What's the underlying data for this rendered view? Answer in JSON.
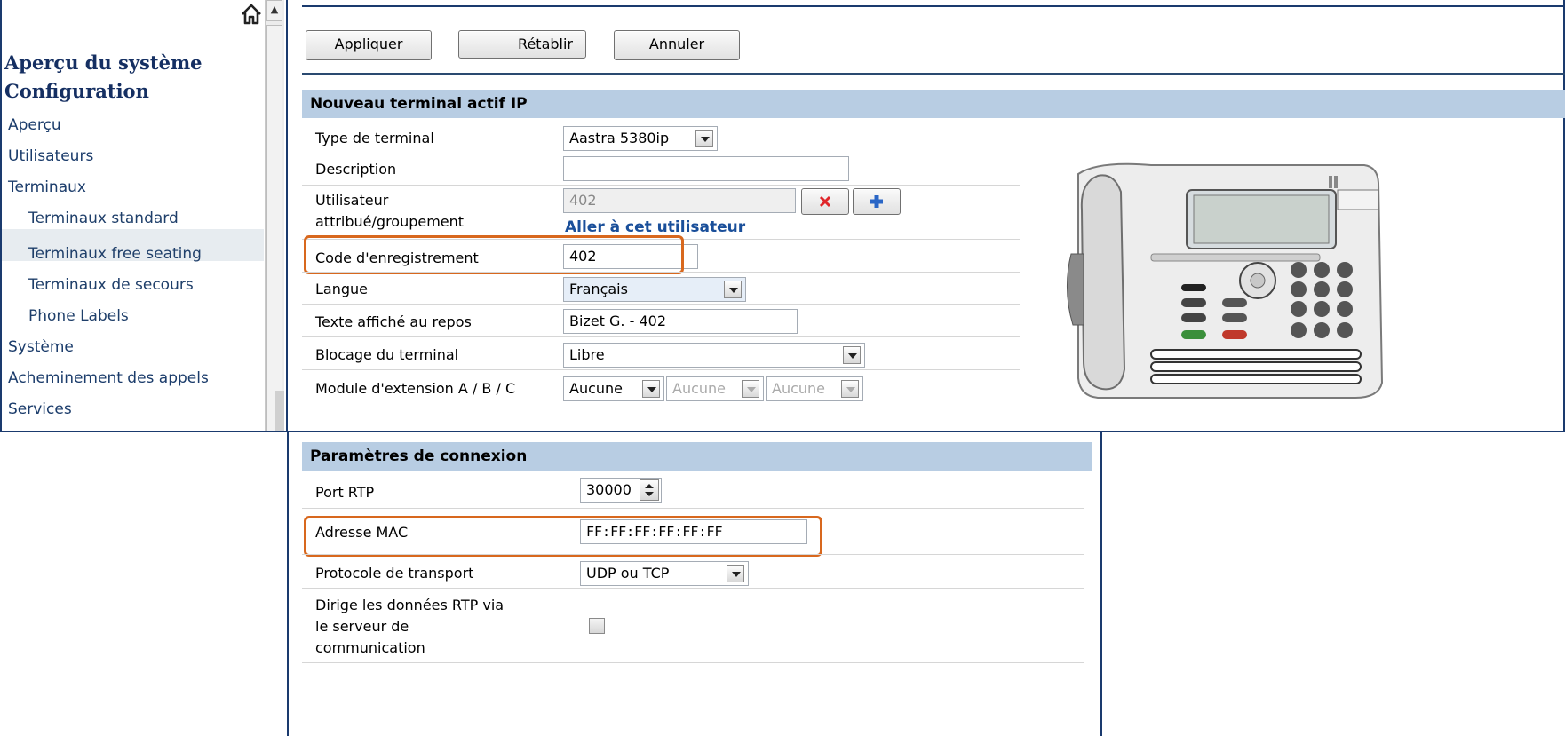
{
  "sidebar": {
    "titles": [
      "Aperçu du système",
      "Configuration"
    ],
    "items": [
      {
        "label": "Aperçu"
      },
      {
        "label": "Utilisateurs"
      },
      {
        "label": "Terminaux"
      },
      {
        "label": "Terminaux standard",
        "active": true,
        "sub": true
      },
      {
        "label": "Terminaux free seating",
        "sub": true
      },
      {
        "label": "Terminaux de secours",
        "sub": true
      },
      {
        "label": "Phone Labels",
        "sub": true
      },
      {
        "label": "Système"
      },
      {
        "label": "Acheminement des appels"
      },
      {
        "label": "Services"
      }
    ]
  },
  "toolbar": {
    "apply_label": "Appliquer",
    "reset_label": "Rétablir",
    "cancel_label": "Annuler"
  },
  "terminal_section": {
    "header": "Nouveau terminal actif IP",
    "type_label": "Type de terminal",
    "type_value": "Aastra 5380ip",
    "description_label": "Description",
    "description_value": "",
    "user_label_line1": "Utilisateur",
    "user_label_line2": "attribué/groupement",
    "user_value": "402",
    "user_link": "Aller à cet utilisateur",
    "reg_code_label": "Code d'enregistrement",
    "reg_code_value": "402",
    "language_label": "Langue",
    "language_value": "Français",
    "idle_text_label": "Texte affiché au repos",
    "idle_text_value": "Bizet G. - 402",
    "lock_label": "Blocage du terminal",
    "lock_value": "Libre",
    "ext_module_label": "Module d'extension A / B / C",
    "ext_module_values": [
      "Aucune",
      "Aucune",
      "Aucune"
    ]
  },
  "connection_section": {
    "header": "Paramètres de connexion",
    "rtp_port_label": "Port RTP",
    "rtp_port_value": "30000",
    "mac_label": "Adresse MAC",
    "mac_value": "FF:FF:FF:FF:FF:FF",
    "transport_label": "Protocole de transport",
    "transport_value": "UDP ou TCP",
    "rtp_via_server_label_lines": [
      "Dirige les données RTP via",
      "le serveur de",
      "communication"
    ],
    "rtp_via_server_checked": false
  },
  "colors": {
    "accent_dark_blue": "#1a3a6e",
    "section_header_bg": "#b8cde3",
    "highlight_orange": "#d8681e",
    "link_blue": "#1a4f9a"
  }
}
